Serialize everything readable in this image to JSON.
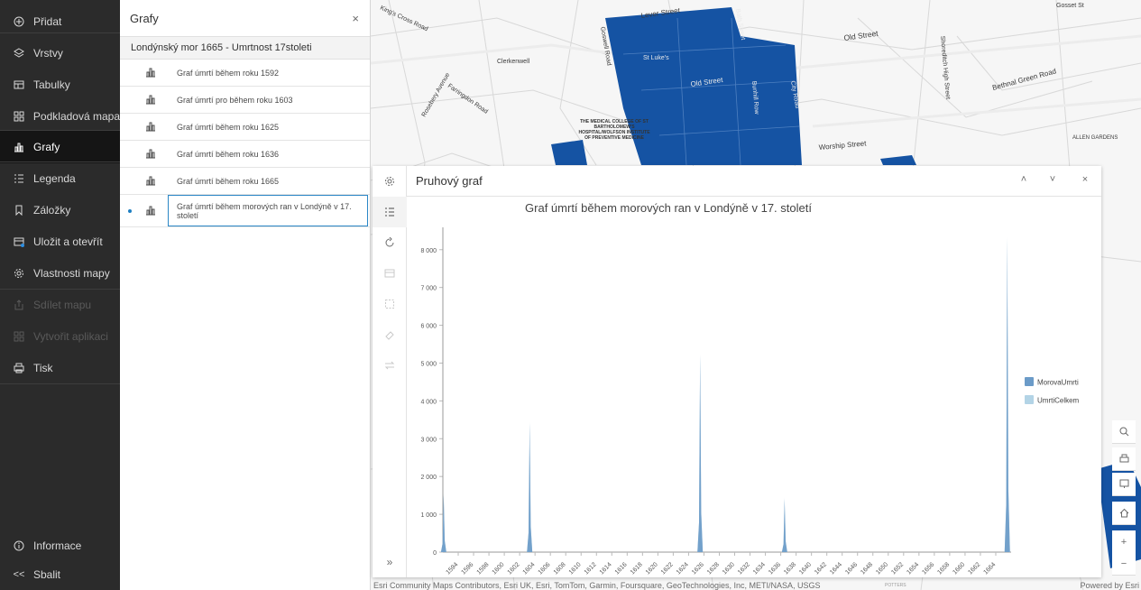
{
  "nav": {
    "items": [
      {
        "label": "Přidat",
        "icon": "plus-circle-icon"
      },
      {
        "label": "Vrstvy",
        "icon": "layers-icon"
      },
      {
        "label": "Tabulky",
        "icon": "table-icon"
      },
      {
        "label": "Podkladová mapa",
        "icon": "basemap-icon"
      },
      {
        "label": "Grafy",
        "icon": "chart-icon"
      },
      {
        "label": "Legenda",
        "icon": "legend-icon"
      },
      {
        "label": "Záložky",
        "icon": "bookmark-icon"
      },
      {
        "label": "Uložit a otevřít",
        "icon": "save-icon"
      },
      {
        "label": "Vlastnosti mapy",
        "icon": "gear-icon"
      },
      {
        "label": "Sdílet mapu",
        "icon": "share-icon"
      },
      {
        "label": "Vytvořit aplikaci",
        "icon": "apps-icon"
      },
      {
        "label": "Tisk",
        "icon": "print-icon"
      }
    ],
    "footer": [
      {
        "label": "Informace",
        "icon": "info-icon"
      },
      {
        "label": "Sbalit",
        "icon": "collapse-icon"
      }
    ]
  },
  "panel": {
    "title": "Grafy",
    "close": "×",
    "group": "Londýnský mor 1665 - Umrtnost 17stoleti",
    "charts": [
      "Graf úmrtí během roku 1592",
      "Graf úmrtí pro během roku 1603",
      "Graf úmrtí během roku 1625",
      "Graf úmrtí během roku 1636",
      "Graf úmrtí během roku 1665",
      "Graf úmrtí během morových ran v Londýně v 17. století"
    ]
  },
  "map": {
    "labels": {
      "lever": "Lever Street",
      "old": "Old Street",
      "oldst2": "Old Street",
      "clerkenwell": "Clerkenwell",
      "stlukes": "St Luke's",
      "worship": "Worship Street",
      "bethnal": "Bethnal Green Road",
      "shoreditch": "Shoreditch High Street",
      "gosset": "Gosset St",
      "allen": "ALLEN GARDENS",
      "farringdon": "Farringdon Road",
      "rosebery": "Rosebery Avenue",
      "kingscross": "King's Cross Road",
      "goswell": "Goswell Road",
      "bath": "Bath Street",
      "cityroad": "City Road",
      "bunhill": "Bunhill Row",
      "college": "THE MEDICAL COLLEGE OF ST BARTHOLOMEW'S HOSPITAL/WOLFSON INSTITUTE OF PREVENTIVE MEDICINE",
      "potters": "POTTERS"
    },
    "attribution": "Esri Community Maps Contributors, Esri UK, Esri, TomTom, Garmin, Foursquare, GeoTechnologies, Inc, METI/NASA, USGS",
    "powered": "Powered by Esri",
    "tools": {
      "zoom_in": "+",
      "zoom_out": "−"
    }
  },
  "chart_window": {
    "title": "Pruhový graf",
    "tools": {
      "expand": "»",
      "collapse_up": "˄",
      "collapse_down": "˅",
      "close": "×"
    }
  },
  "chart_data": {
    "type": "area",
    "title": "Graf úmrtí během morových ran v Londýně v 17. století",
    "ylim": [
      0,
      8400
    ],
    "yticks": [
      0,
      1000,
      2000,
      3000,
      4000,
      5000,
      6000,
      7000,
      8000
    ],
    "ytick_labels": [
      "0",
      "1 000",
      "2 000",
      "3 000",
      "4 000",
      "5 000",
      "6 000",
      "7 000",
      "8 000"
    ],
    "xlim": [
      1592,
      1666
    ],
    "xticks": [
      "1594",
      "1596",
      "1598",
      "1600",
      "1602",
      "1604",
      "1606",
      "1608",
      "1610",
      "1612",
      "1614",
      "1616",
      "1618",
      "1620",
      "1622",
      "1624",
      "1626",
      "1628",
      "1630",
      "1632",
      "1634",
      "1636",
      "1638",
      "1640",
      "1642",
      "1644",
      "1646",
      "1648",
      "1650",
      "1652",
      "1654",
      "1656",
      "1658",
      "1660",
      "1662",
      "1664"
    ],
    "legend_position": "right",
    "colors": {
      "MorovaUmrti": "#6b9bc8",
      "UmrtiCelkem": "#b3d4e6"
    },
    "series": [
      {
        "name": "MorovaUmrti",
        "peaks": [
          [
            1592.1,
            1500
          ],
          [
            1603.3,
            3400
          ],
          [
            1625.5,
            5200
          ],
          [
            1636.5,
            1400
          ],
          [
            1665.5,
            8300
          ]
        ]
      },
      {
        "name": "UmrtiCelkem",
        "peaks": [
          [
            1592.1,
            1550
          ],
          [
            1603.3,
            3450
          ],
          [
            1625.5,
            5250
          ],
          [
            1636.5,
            1450
          ],
          [
            1665.5,
            8350
          ]
        ]
      }
    ]
  }
}
